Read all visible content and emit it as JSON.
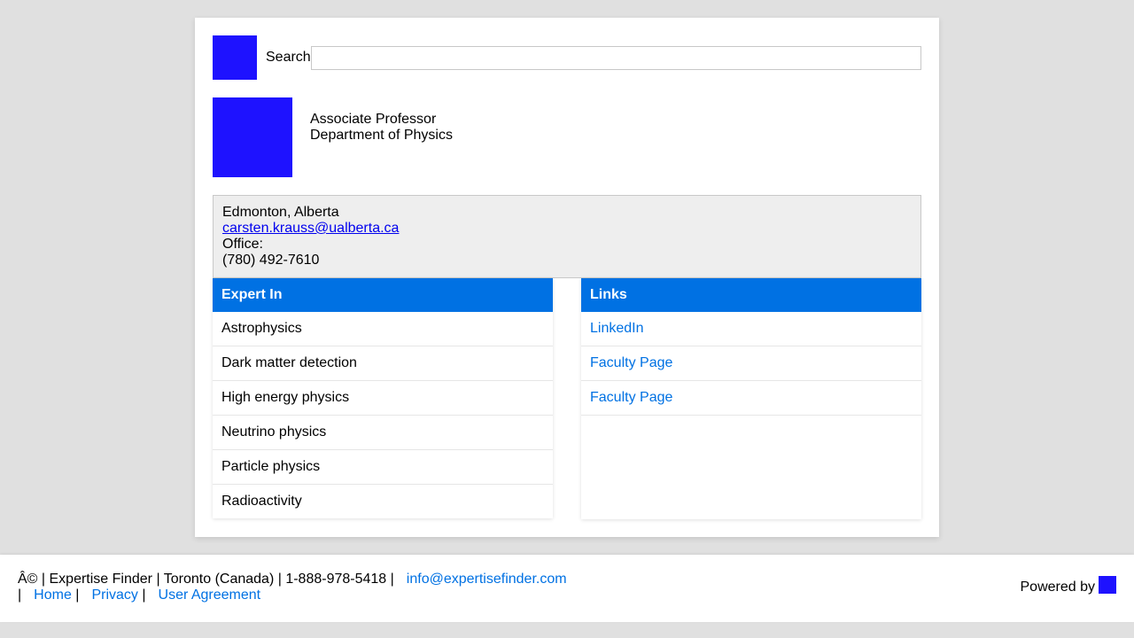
{
  "search": {
    "label": "Search",
    "value": "",
    "placeholder": ""
  },
  "profile": {
    "title": "Associate Professor",
    "department": "Department of Physics"
  },
  "contact": {
    "location": "Edmonton, Alberta",
    "email": "carsten.krauss@ualberta.ca",
    "office_label": "Office:",
    "phone": "(780) 492-7610"
  },
  "expert_in": {
    "header": "Expert In",
    "items": [
      "Astrophysics",
      "Dark matter detection",
      "High energy physics",
      "Neutrino physics",
      "Particle physics",
      "Radioactivity"
    ]
  },
  "links": {
    "header": "Links",
    "items": [
      "LinkedIn",
      "Faculty Page",
      "Faculty Page"
    ]
  },
  "footer": {
    "info_text": "Â© | Expertise Finder | Toronto (Canada) | 1-888-978-5418 |",
    "email": "info@expertisefinder.com",
    "sep": "|",
    "nav": [
      "Home",
      "Privacy",
      "User Agreement"
    ],
    "powered_by": "Powered by"
  },
  "colors": {
    "brand_square": "#1e12ff",
    "accent": "#0071e3",
    "background": "#e0e0e0"
  },
  "icons": {
    "site_logo": "logo-square-icon",
    "avatar": "profile-photo-placeholder",
    "powered_logo": "powered-by-logo-icon"
  }
}
